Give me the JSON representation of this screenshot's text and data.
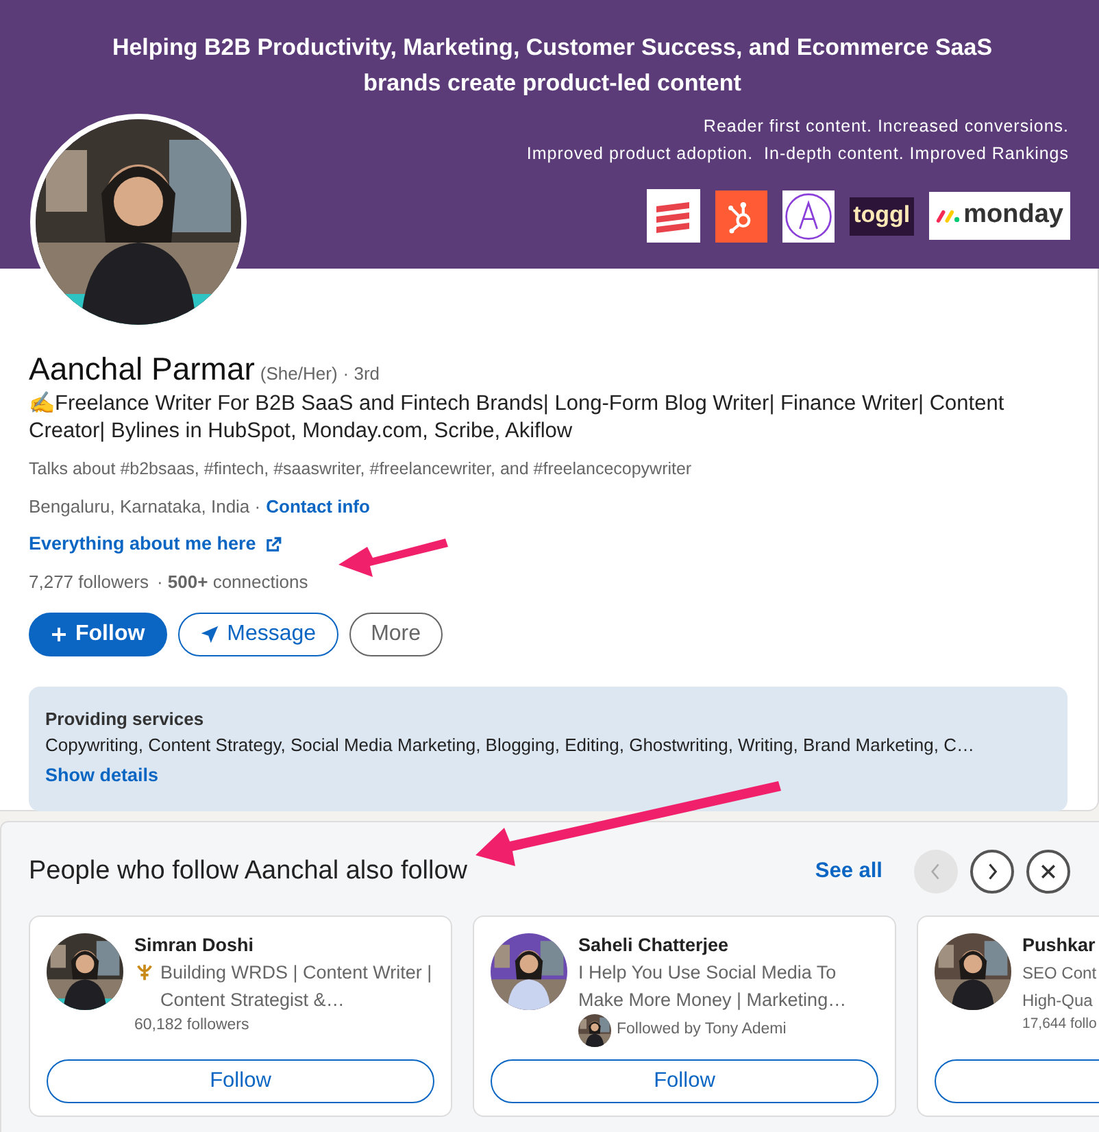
{
  "banner": {
    "headline_lines": [
      "Helping B2B Productivity, Marketing, Customer Success, and Ecommerce SaaS",
      "brands create product-led content"
    ],
    "tagline_lines": [
      "Reader first content. Increased conversions.",
      "Improved product adoption.  In-depth content. Improved Rankings"
    ],
    "logos": [
      {
        "kind": "stripes"
      },
      {
        "kind": "hub"
      },
      {
        "kind": "triangle"
      },
      {
        "kind": "toggl",
        "text": "toggl"
      },
      {
        "kind": "monday",
        "text": "monday"
      }
    ]
  },
  "profile": {
    "name": "Aanchal Parmar",
    "pronouns": "(She/Her)",
    "degree": "· 3rd",
    "headline": "✍Freelance Writer For B2B SaaS and Fintech Brands| Long-Form Blog Writer| Finance Writer| Content Creator| Bylines in HubSpot, Monday.com, Scribe, Akiflow",
    "talks_about": "Talks about #b2bsaas, #fintech, #saaswriter, #freelancewriter, and #freelancecopywriter",
    "location": "Bengaluru, Karnataka, India ·",
    "contact_link": "Contact info",
    "website_link": "Everything about me here",
    "followers": "7,277 followers",
    "connections": "· **500+** connections",
    "buttons": [
      {
        "kind": "primary",
        "label": "Follow"
      },
      {
        "kind": "outline",
        "label": "Message"
      },
      {
        "kind": "secondary",
        "label": "More"
      }
    ]
  },
  "services": {
    "title": "Providing services",
    "text": "Copywriting, Content Strategy, Social Media Marketing, Blogging, Editing, Ghostwriting, Writing, Brand Marketing, C…",
    "link": "Show details"
  },
  "suggestions": {
    "title": "People who follow Aanchal also follow",
    "see_all": "See all",
    "prev": {
      "disabled": true
    },
    "next": {
      "disabled": false
    },
    "people": [
      {
        "name": "Simran Doshi",
        "headline": "Building WRDS | Content Writer | Content Strategist &…",
        "badge": true,
        "meta": "60,182 followers",
        "followed_by": false,
        "button": "Follow"
      },
      {
        "name": "Saheli Chatterjee",
        "headline": "I Help You Use Social Media To Make More Money | Marketing…",
        "badge": false,
        "meta": "Followed by Tony Ademi",
        "followed_by": true,
        "button": "Follow"
      },
      {
        "name": "Pushkar",
        "headline": "SEO Cont High-Qua",
        "badge": false,
        "meta": "17,644 follo",
        "followed_by": false
      }
    ]
  }
}
